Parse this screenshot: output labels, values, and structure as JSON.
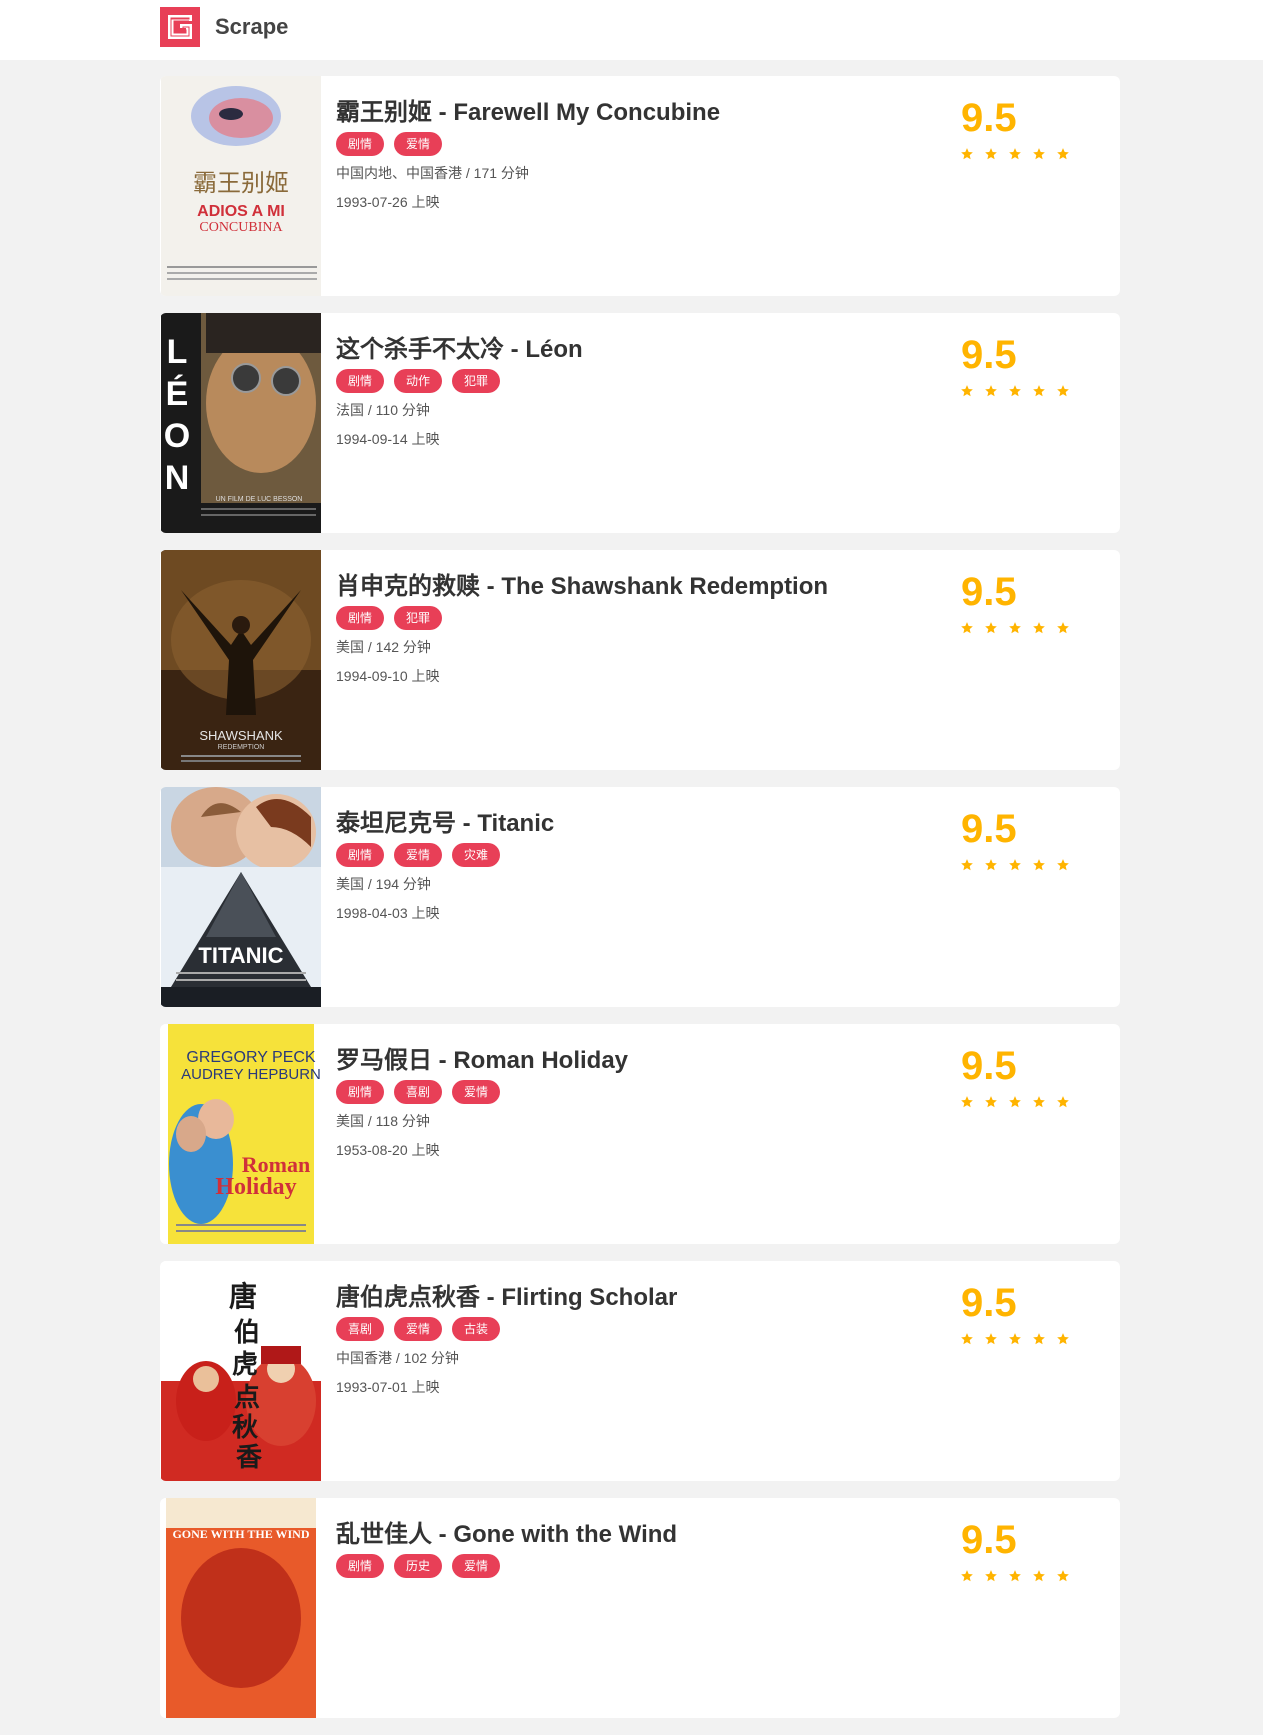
{
  "header": {
    "title": "Scrape"
  },
  "colors": {
    "accent": "#e83f57",
    "score": "#ffb400",
    "background": "#f2f2f2"
  },
  "movies": [
    {
      "name_cn": "霸王别姬",
      "name_en": "Farewell My Concubine",
      "title": "霸王别姬 - Farewell My Concubine",
      "categories": [
        "剧情",
        "爱情"
      ],
      "region_duration": "中国内地、中国香港 / 171 分钟",
      "release": "1993-07-26 上映",
      "score": "9.5",
      "stars": 5,
      "poster": {
        "icon": "poster-image",
        "caption_lines": [
          "霸王别姬",
          "ADIOS A MI",
          "CONCUBINA"
        ]
      }
    },
    {
      "name_cn": "这个杀手不太冷",
      "name_en": "Léon",
      "title": "这个杀手不太冷 - Léon",
      "categories": [
        "剧情",
        "动作",
        "犯罪"
      ],
      "region_duration": "法国 / 110 分钟",
      "release": "1994-09-14 上映",
      "score": "9.5",
      "stars": 5,
      "poster": {
        "icon": "poster-image",
        "caption_lines": [
          "LÉON",
          "UN FILM DE LUC BESSON"
        ]
      }
    },
    {
      "name_cn": "肖申克的救赎",
      "name_en": "The Shawshank Redemption",
      "title": "肖申克的救赎 - The Shawshank Redemption",
      "categories": [
        "剧情",
        "犯罪"
      ],
      "region_duration": "美国 / 142 分钟",
      "release": "1994-09-10 上映",
      "score": "9.5",
      "stars": 5,
      "poster": {
        "icon": "poster-image",
        "caption_lines": [
          "SHAWSHANK",
          "REDEMPTION"
        ]
      }
    },
    {
      "name_cn": "泰坦尼克号",
      "name_en": "Titanic",
      "title": "泰坦尼克号 - Titanic",
      "categories": [
        "剧情",
        "爱情",
        "灾难"
      ],
      "region_duration": "美国 / 194 分钟",
      "release": "1998-04-03 上映",
      "score": "9.5",
      "stars": 5,
      "poster": {
        "icon": "poster-image",
        "caption_lines": [
          "TITANIC"
        ]
      }
    },
    {
      "name_cn": "罗马假日",
      "name_en": "Roman Holiday",
      "title": "罗马假日 - Roman Holiday",
      "categories": [
        "剧情",
        "喜剧",
        "爱情"
      ],
      "region_duration": "美国 / 118 分钟",
      "release": "1953-08-20 上映",
      "score": "9.5",
      "stars": 5,
      "poster": {
        "icon": "poster-image",
        "caption_lines": [
          "GREGORY PECK",
          "AUDREY HEPBURN",
          "Roman",
          "Holiday"
        ]
      }
    },
    {
      "name_cn": "唐伯虎点秋香",
      "name_en": "Flirting Scholar",
      "title": "唐伯虎点秋香 - Flirting Scholar",
      "categories": [
        "喜剧",
        "爱情",
        "古装"
      ],
      "region_duration": "中国香港 / 102 分钟",
      "release": "1993-07-01 上映",
      "score": "9.5",
      "stars": 5,
      "poster": {
        "icon": "poster-image",
        "caption_lines": [
          "唐伯虎点秋香"
        ]
      }
    },
    {
      "name_cn": "乱世佳人",
      "name_en": "Gone with the Wind",
      "title": "乱世佳人 - Gone with the Wind",
      "categories": [
        "剧情",
        "历史",
        "爱情"
      ],
      "region_duration": "",
      "release": "",
      "score": "9.5",
      "stars": 5,
      "poster": {
        "icon": "poster-image",
        "caption_lines": [
          "GONE WITH THE WIND"
        ]
      }
    }
  ]
}
